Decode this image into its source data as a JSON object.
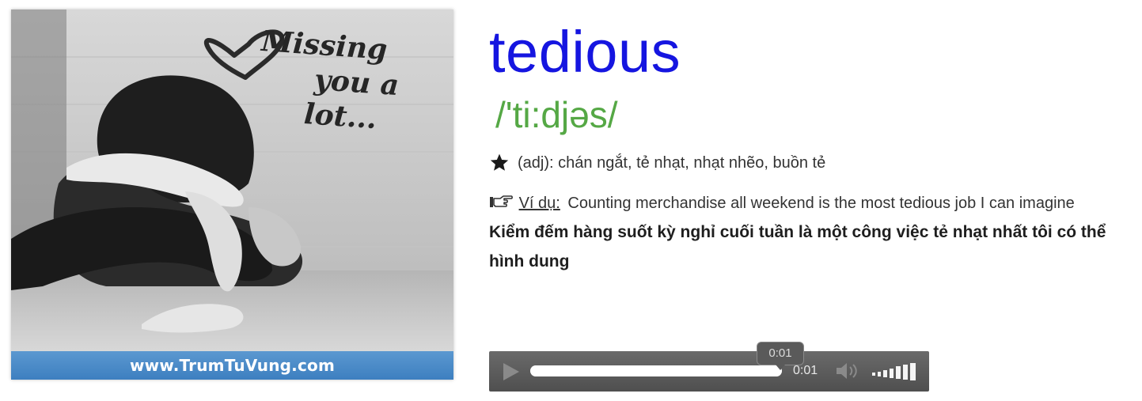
{
  "illustration": {
    "handwritten_text": [
      "Missing",
      "you a",
      "lot..."
    ],
    "caption": "www.TrumTuVung.com",
    "icon": "heart-icon"
  },
  "entry": {
    "word": "tedious",
    "pronunciation": "/'ti:djəs/",
    "part_of_speech": "(adj):",
    "meaning": "chán ngắt, tẻ nhạt, nhạt nhẽo, buồn tẻ",
    "meaning_icon": "star-icon",
    "example_icon": "pointing-hand-icon",
    "example_label": "Ví dụ:",
    "example_sentence": "Counting merchandise all weekend is the most tedious job I can imagine",
    "example_translation": "Kiểm đếm hàng suốt kỳ nghỉ cuối tuần là một công việc tẻ nhạt nhất tôi có thể hình dung"
  },
  "audio_player": {
    "tooltip_time": "0:01",
    "current_time": "0:01",
    "progress_fraction": 1.0,
    "volume_level_fraction": 1.0,
    "icons": [
      "play-icon",
      "volume-icon",
      "volume-level-icon"
    ]
  },
  "colors": {
    "headword": "#1515e0",
    "pronunciation": "#55a845",
    "caption_band": "#4a8bc8",
    "player_background": "#5c5c5c"
  }
}
